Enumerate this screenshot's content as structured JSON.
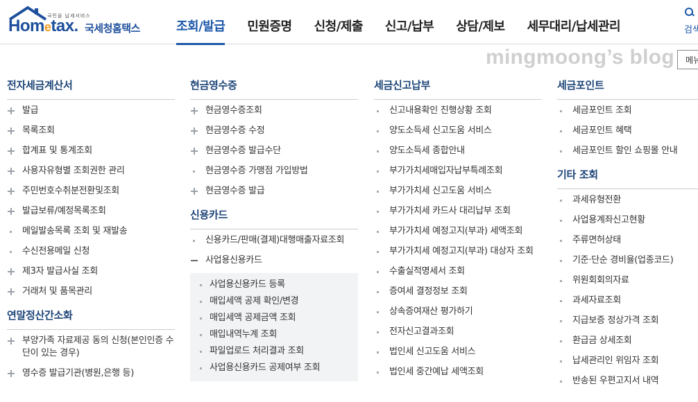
{
  "logo": {
    "tagline": "국민을 납세서비스",
    "main_home": "Hom",
    "main_e": "e",
    "main_tax": "tax.",
    "sub": "국세청홈택스"
  },
  "gnb": [
    {
      "label": "조회/발급",
      "active": true
    },
    {
      "label": "민원증명"
    },
    {
      "label": "신청/제출"
    },
    {
      "label": "신고/납부"
    },
    {
      "label": "상담/제보"
    },
    {
      "label": "세무대리/납세관리"
    }
  ],
  "search": {
    "label": "검색"
  },
  "watermark": "mingmoong’s blog",
  "menu_button": "메뉴",
  "colors": {
    "brand": "#1d4f9c",
    "accent": "#f39a1b",
    "active": "#1a56a8"
  },
  "col1": {
    "title": "전자세금계산서",
    "items": [
      {
        "label": "발급",
        "icon": "plus"
      },
      {
        "label": "목록조회",
        "icon": "plus"
      },
      {
        "label": "합계표 및 통계조회",
        "icon": "plus"
      },
      {
        "label": "사용자유형별 조회권한 관리",
        "icon": "plus"
      },
      {
        "label": "주민번호수취분전환및조회",
        "icon": "plus"
      },
      {
        "label": "발급보류/예정목록조회",
        "icon": "plus"
      },
      {
        "label": "메일발송목록 조회 및 재발송",
        "icon": "dot"
      },
      {
        "label": "수신전용메일 신청",
        "icon": "dot"
      },
      {
        "label": "제3자 발급사실 조회",
        "icon": "plus"
      },
      {
        "label": "거래처 및 품목관리",
        "icon": "plus"
      }
    ],
    "title2": "연말정산간소화",
    "items2": [
      {
        "label": "부양가족 자료제공 동의 신청(본인인증 수단이 있는 경우)",
        "icon": "plus"
      },
      {
        "label": "영수증 발급기관(병원,은행 등)",
        "icon": "plus"
      }
    ]
  },
  "col2": {
    "title": "현금영수증",
    "items": [
      {
        "label": "현금영수증조회",
        "icon": "plus"
      },
      {
        "label": "현금영수증 수정",
        "icon": "plus"
      },
      {
        "label": "현금영수증 발급수단",
        "icon": "plus"
      },
      {
        "label": "현금영수증 가맹점 가입방법",
        "icon": "dot"
      },
      {
        "label": "현금영수증 발급",
        "icon": "plus"
      }
    ],
    "title2": "신용카드",
    "items2": [
      {
        "label": "신용카드/판매(결제)대행매출자료조회",
        "icon": "dot"
      },
      {
        "label": "사업용신용카드",
        "icon": "minus"
      }
    ],
    "sub": [
      "사업용신용카드 등록",
      "매입세액 공제 확인/변경",
      "매입세액 공제금액 조회",
      "매입내역누계 조회",
      "파일업로드 처리결과 조회",
      "사업용신용카드 공제여부 조회"
    ]
  },
  "col3": {
    "title": "세금신고납부",
    "items": [
      {
        "label": "신고내용확인 진행상황 조회",
        "icon": "dot"
      },
      {
        "label": "양도소득세 신고도움 서비스",
        "icon": "dot"
      },
      {
        "label": "양도소득세 종합안내",
        "icon": "dot"
      },
      {
        "label": "부가가치세매입자납부특례조회",
        "icon": "dot"
      },
      {
        "label": "부가가치세 신고도움 서비스",
        "icon": "dot"
      },
      {
        "label": "부가가치세 카드사 대리납부 조회",
        "icon": "dot"
      },
      {
        "label": "부가가치세 예정고지(부과) 세액조회",
        "icon": "dot"
      },
      {
        "label": "부가가치세 예정고지(부과) 대상자 조회",
        "icon": "dot"
      },
      {
        "label": "수출실적명세서 조회",
        "icon": "dot"
      },
      {
        "label": "증여세 결정정보 조회",
        "icon": "dot"
      },
      {
        "label": "상속증여재산 평가하기",
        "icon": "dot"
      },
      {
        "label": "전자신고결과조회",
        "icon": "dot"
      },
      {
        "label": "법인세 신고도움 서비스",
        "icon": "dot"
      },
      {
        "label": "법인세 중간예납 세액조회",
        "icon": "dot"
      }
    ]
  },
  "col4": {
    "title": "세금포인트",
    "items": [
      {
        "label": "세금포인트 조회",
        "icon": "dot"
      },
      {
        "label": "세금포인트 혜택",
        "icon": "dot"
      },
      {
        "label": "세금포인트 할인 쇼핑몰 안내",
        "icon": "dot"
      }
    ],
    "title2": "기타 조회",
    "items2": [
      {
        "label": "과세유형전환",
        "icon": "dot"
      },
      {
        "label": "사업용계좌신고현황",
        "icon": "dot"
      },
      {
        "label": "주류면허상태",
        "icon": "dot"
      },
      {
        "label": "기준·단순 경비율(업종코드)",
        "icon": "dot"
      },
      {
        "label": "위원회회의자료",
        "icon": "dot"
      },
      {
        "label": "과세자료조회",
        "icon": "dot"
      },
      {
        "label": "지급보증 정상가격 조회",
        "icon": "dot"
      },
      {
        "label": "환급금 상세조회",
        "icon": "dot"
      },
      {
        "label": "납세관리인 위임자 조회",
        "icon": "dot"
      },
      {
        "label": "반송된 우편고지서 내역",
        "icon": "dot"
      }
    ]
  }
}
